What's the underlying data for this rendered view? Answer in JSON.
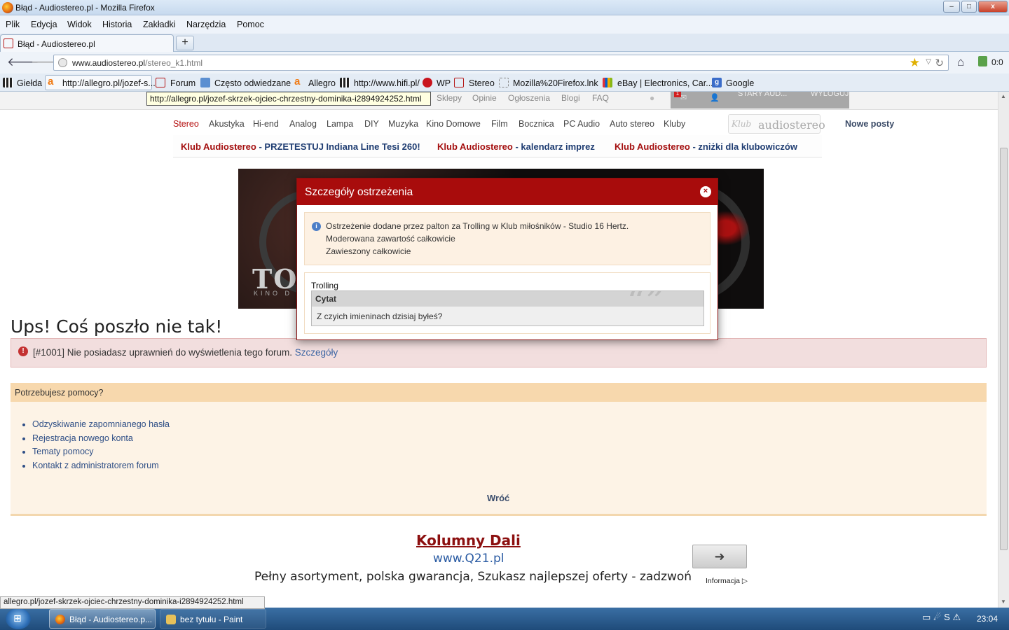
{
  "window": {
    "title": "Błąd - Audiostereo.pl - Mozilla Firefox",
    "minimize": "–",
    "maximize": "□",
    "close": "x"
  },
  "menubar": {
    "items": [
      "Plik",
      "Edycja",
      "Widok",
      "Historia",
      "Zakładki",
      "Narzędzia",
      "Pomoc"
    ]
  },
  "tabs": {
    "active_label": "Błąd - Audiostereo.pl",
    "new_tab": "+"
  },
  "navbar": {
    "back": "🡐",
    "forward": "🡒",
    "url_host": "www.audiostereo.pl",
    "url_path": "/stereo_k1.html",
    "star": "★",
    "dropdown": "▽",
    "reload": "↻",
    "home": "⌂",
    "addon_count": "0:0"
  },
  "bookmarks": {
    "items": [
      {
        "label": "Giełda",
        "icon": "dots-icon"
      },
      {
        "label": "http://allegro.pl/jozef-s...",
        "icon": "allegro-icon"
      },
      {
        "label": "Forum",
        "icon": "audiostereo-icon"
      },
      {
        "label": "Często odwiedzane",
        "icon": "smart-folder-icon"
      },
      {
        "label": "Allegro",
        "icon": "allegro-icon"
      },
      {
        "label": "http://www.hifi.pl/",
        "icon": "dots-icon"
      },
      {
        "label": "WP",
        "icon": "wp-icon"
      },
      {
        "label": "Stereo",
        "icon": "audiostereo-icon"
      },
      {
        "label": "Mozilla%20Firefox.lnk",
        "icon": "blank-page-icon"
      },
      {
        "label": "eBay | Electronics, Car...",
        "icon": "ebay-icon"
      },
      {
        "label": "Google",
        "icon": "google-icon"
      }
    ]
  },
  "tooltip": "http://allegro.pl/jozef-skrzek-ojciec-chrzestny-dominika-i2894924252.html",
  "site": {
    "topnav": [
      "Sklepy",
      "Opinie",
      "Ogłoszenia",
      "Blogi",
      "FAQ"
    ],
    "user": {
      "name": "STARY AUD...",
      "logout": "WYLOGUJ",
      "notifications": "1"
    },
    "categories": [
      "Stereo",
      "Akustyka",
      "Hi-end",
      "Analog",
      "Lampa",
      "DIY",
      "Muzyka",
      "Kino Domowe",
      "Film",
      "Bocznica",
      "PC Audio",
      "Auto stereo",
      "Kluby"
    ],
    "klub_logo": {
      "script": "Klub",
      "name": "audiostereo"
    },
    "new_posts": "Nowe posty",
    "promos": [
      {
        "brand": "Klub Audiostereo",
        "text": " - PRZETESTUJ Indiana Line Tesi 260!"
      },
      {
        "brand": "Klub Audiostereo",
        "text": " - kalendarz imprez"
      },
      {
        "brand": "Klub Audiostereo",
        "text": " - zniżki dla klubowiczów"
      }
    ],
    "banner": {
      "title": "TO",
      "subtitle": "KINO D"
    },
    "error": {
      "heading": "Ups! Coś poszło nie tak!",
      "message": "[#1001] Nie posiadasz uprawnień do wyświetlenia tego forum. ",
      "link": "Szczegóły",
      "icon": "!"
    },
    "help": {
      "title": "Potrzebujesz pomocy?",
      "links": [
        "Odzyskiwanie zapomnianego hasła",
        "Rejestracja nowego konta",
        "Tematy pomocy",
        "Kontakt z administratorem forum"
      ],
      "back": "Wróć"
    },
    "ad": {
      "title": "Kolumny Dali",
      "url": "www.Q21.pl",
      "description": "Pełny asortyment, polska gwarancja, Szukasz najlepszej oferty - zadzwoń",
      "button": "➜",
      "info": "Informacja ▷"
    }
  },
  "modal": {
    "title": "Szczegóły ostrzeżenia",
    "close": "×",
    "info_icon": "i",
    "info_lines": [
      "Ostrzeżenie dodane przez palton za Trolling w Klub miłośników - Studio 16 Hertz.",
      "Moderowana zawartość całkowicie",
      "Zawieszony całkowicie"
    ],
    "reason": "Trolling",
    "quote_header": "Cytat",
    "quote_marks": "“”",
    "quote_text": "Z czyich imieninach dzisiaj byłeś?"
  },
  "statusbar": "allegro.pl/jozef-skrzek-ojciec-chrzestny-dominika-i2894924252.html",
  "taskbar": {
    "start": "⊞",
    "tasks": [
      {
        "label": "Błąd - Audiostereo.p...",
        "active": true
      },
      {
        "label": "bez tytułu - Paint",
        "active": false
      }
    ],
    "tray": "▭ ☄ S ⚠",
    "clock": "23:04"
  },
  "colors": {
    "accent": "#a80c0c",
    "link": "#2f4f86",
    "error_bg": "#f2dede",
    "help_header": "#f7d8ad"
  }
}
